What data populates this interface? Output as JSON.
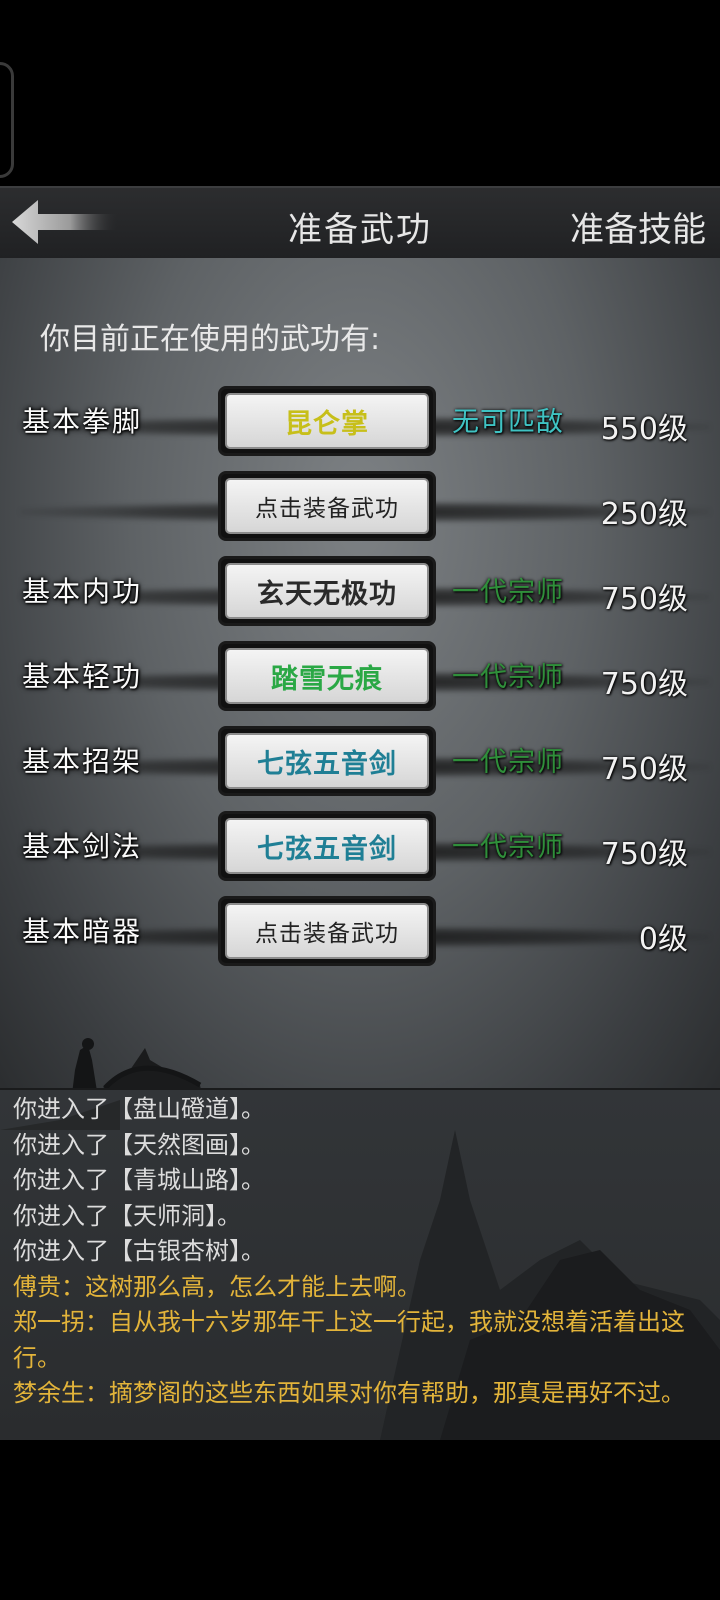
{
  "header": {
    "title": "准备武功",
    "skills_link": "准备技能"
  },
  "intro": "你目前正在使用的武功有:",
  "slots": [
    {
      "category": "基本拳脚",
      "skill": "昆仑掌",
      "skill_color": "#c7bf1a",
      "grade": "无可匹敌",
      "grade_color": "#3fc3c3",
      "level": "550级"
    },
    {
      "category": "",
      "skill": "点击装备武功",
      "skill_color": "#222222",
      "grade": "",
      "grade_color": "",
      "level": "250级"
    },
    {
      "category": "基本内功",
      "skill": "玄天无极功",
      "skill_color": "#2a2a2a",
      "grade": "一代宗师",
      "grade_color": "#2f8f3a",
      "level": "750级"
    },
    {
      "category": "基本轻功",
      "skill": "踏雪无痕",
      "skill_color": "#2aa845",
      "grade": "一代宗师",
      "grade_color": "#2f8f3a",
      "level": "750级"
    },
    {
      "category": "基本招架",
      "skill": "七弦五音剑",
      "skill_color": "#1f7f95",
      "grade": "一代宗师",
      "grade_color": "#2f8f3a",
      "level": "750级"
    },
    {
      "category": "基本剑法",
      "skill": "七弦五音剑",
      "skill_color": "#1f7f95",
      "grade": "一代宗师",
      "grade_color": "#2f8f3a",
      "level": "750级"
    },
    {
      "category": "基本暗器",
      "skill": "点击装备武功",
      "skill_color": "#222222",
      "grade": "",
      "grade_color": "",
      "level": "0级"
    }
  ],
  "log": [
    {
      "type": "sys",
      "text": "你进入了【盘山磴道】。"
    },
    {
      "type": "sys",
      "text": "你进入了【天然图画】。"
    },
    {
      "type": "sys",
      "text": "你进入了【青城山路】。"
    },
    {
      "type": "sys",
      "text": "你进入了【天师洞】。"
    },
    {
      "type": "sys",
      "text": "你进入了【古银杏树】。"
    },
    {
      "type": "talk",
      "text": "傅贵：这树那么高，怎么才能上去啊。"
    },
    {
      "type": "talk",
      "text": "郑一拐：自从我十六岁那年干上这一行起，我就没想着活着出这行。"
    },
    {
      "type": "talk",
      "text": "梦余生：摘梦阁的这些东西如果对你有帮助，那真是再好不过。"
    }
  ]
}
